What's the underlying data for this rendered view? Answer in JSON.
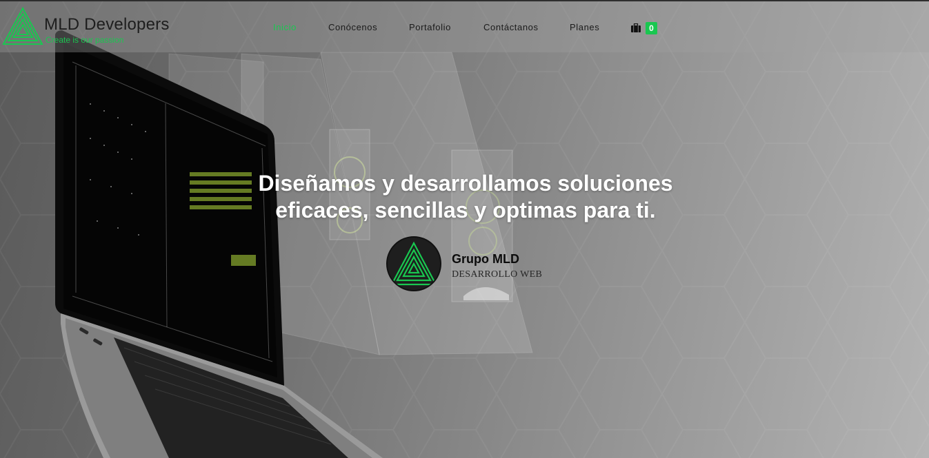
{
  "brand": {
    "name": "MLD Developers",
    "tagline": "Create is our passion"
  },
  "nav": {
    "items": [
      {
        "label": "Inicio",
        "active": true
      },
      {
        "label": "Conócenos",
        "active": false
      },
      {
        "label": "Portafolio",
        "active": false
      },
      {
        "label": "Contáctanos",
        "active": false
      },
      {
        "label": "Planes",
        "active": false
      }
    ],
    "cart_icon": "briefcase-icon",
    "cart_count": "0"
  },
  "hero": {
    "headline_line1": "Diseñamos y desarrollamos soluciones",
    "headline_line2": "eficaces, sencillas y optimas para ti.",
    "group_name": "Grupo MLD",
    "group_role": "DESARROLLO WEB"
  },
  "colors": {
    "accent": "#19c750",
    "badge": "#19c750"
  }
}
